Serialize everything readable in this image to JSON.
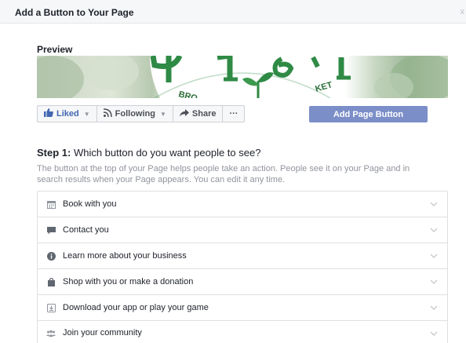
{
  "dialog": {
    "title": "Add a Button to Your Page",
    "close_glyph": "x"
  },
  "preview": {
    "label": "Preview",
    "cover_text_left": "BRO",
    "cover_text_right": "KET"
  },
  "action_bar": {
    "liked": "Liked",
    "following": "Following",
    "share": "Share",
    "more": "···"
  },
  "add_button_label": "Add Page Button",
  "step": {
    "prefix": "Step 1:",
    "question": " Which button do you want people to see?",
    "description": "The button at the top of your Page helps people take an action. People see it on your Page and in search results when your Page appears. You can edit it any time."
  },
  "options": [
    {
      "label": "Book with you",
      "icon": "calendar-icon"
    },
    {
      "label": "Contact you",
      "icon": "message-icon"
    },
    {
      "label": "Learn more about your business",
      "icon": "info-icon"
    },
    {
      "label": "Shop with you or make a donation",
      "icon": "shopping-bag-icon"
    },
    {
      "label": "Download your app or play your game",
      "icon": "download-icon"
    },
    {
      "label": "Join your community",
      "icon": "people-icon"
    }
  ],
  "colors": {
    "primary_button": "#7b8ec8",
    "link_blue": "#4267b2",
    "logo_green": "#2f8a45"
  }
}
